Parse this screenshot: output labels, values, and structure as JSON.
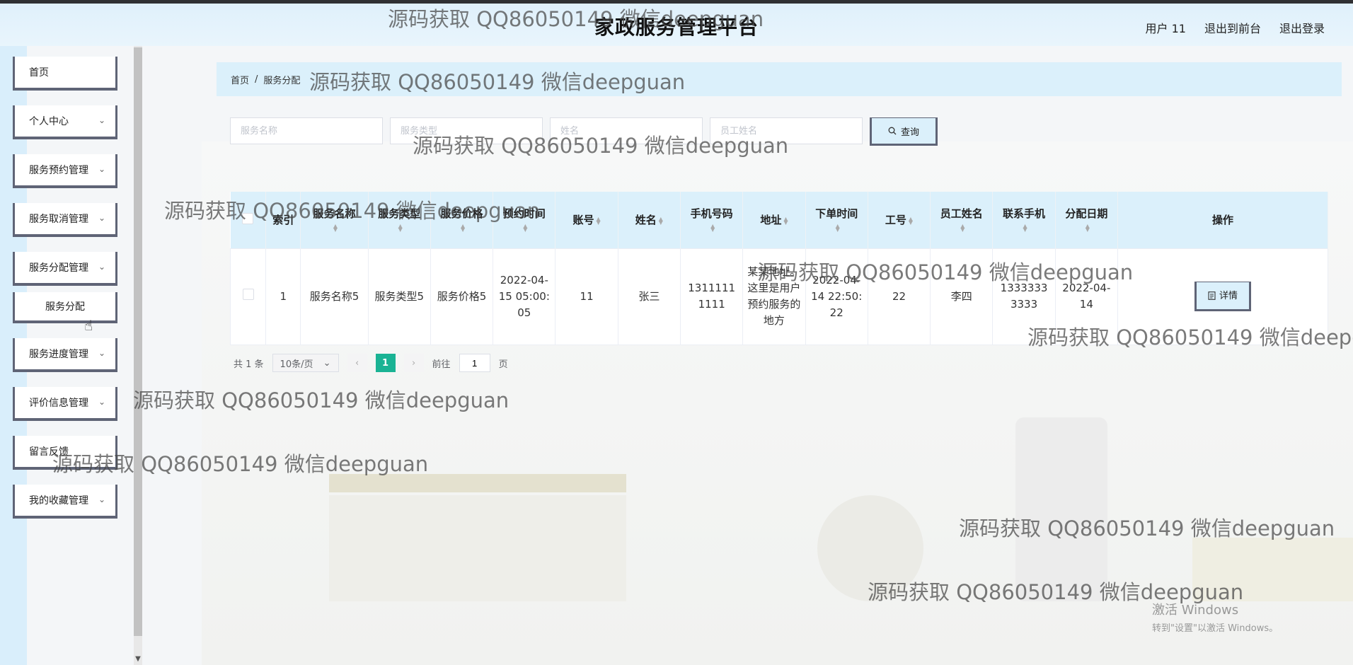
{
  "header": {
    "title": "家政服务管理平台",
    "user_label": "用户 11",
    "front_link": "退出到前台",
    "logout_link": "退出登录"
  },
  "sidebar": {
    "items": [
      {
        "label": "首页",
        "has_chevron": false
      },
      {
        "label": "个人中心",
        "has_chevron": true
      },
      {
        "label": "服务预约管理",
        "has_chevron": true
      },
      {
        "label": "服务取消管理",
        "has_chevron": true
      },
      {
        "label": "服务分配管理",
        "has_chevron": true
      },
      {
        "label": "服务进度管理",
        "has_chevron": true
      },
      {
        "label": "评价信息管理",
        "has_chevron": true
      },
      {
        "label": "留言反馈",
        "has_chevron": false
      },
      {
        "label": "我的收藏管理",
        "has_chevron": true
      }
    ],
    "sub_item": "服务分配"
  },
  "breadcrumb": {
    "home": "首页",
    "sep": "/",
    "current": "服务分配"
  },
  "search": {
    "placeholders": [
      "服务名称",
      "服务类型",
      "姓名",
      "员工姓名"
    ],
    "button_label": "查询"
  },
  "table": {
    "headers": [
      "索引",
      "服务名称",
      "服务类型",
      "服务价格",
      "预约时间",
      "账号",
      "姓名",
      "手机号码",
      "地址",
      "下单时间",
      "工号",
      "员工姓名",
      "联系手机",
      "分配日期",
      "操作"
    ],
    "rows": [
      [
        "1",
        "服务名称5",
        "服务类型5",
        "服务价格5",
        "2022-04-15 05:00:05",
        "11",
        "张三",
        "13111111111",
        "某某地址。这里是用户预约服务的地方",
        "2022-04-14 22:50:22",
        "22",
        "李四",
        "13333333333",
        "2022-04-14"
      ]
    ],
    "detail_label": "详情"
  },
  "pager": {
    "total": "共 1 条",
    "page_size": "10条/页",
    "current_page": "1",
    "goto_prefix": "前往",
    "goto_value": "1",
    "goto_suffix": "页"
  },
  "watermark_text": "源码获取 QQ86050149 微信deepguan",
  "windows_activation": {
    "line1": "激活 Windows",
    "line2": "转到\"设置\"以激活 Windows。"
  },
  "colors": {
    "accent_bg": "#dbf0fb",
    "button_border": "#5f6476",
    "page_active": "#1ab394"
  },
  "icons": {
    "search": "search-icon",
    "detail": "document-icon",
    "chevron": "chevron-down-icon"
  }
}
